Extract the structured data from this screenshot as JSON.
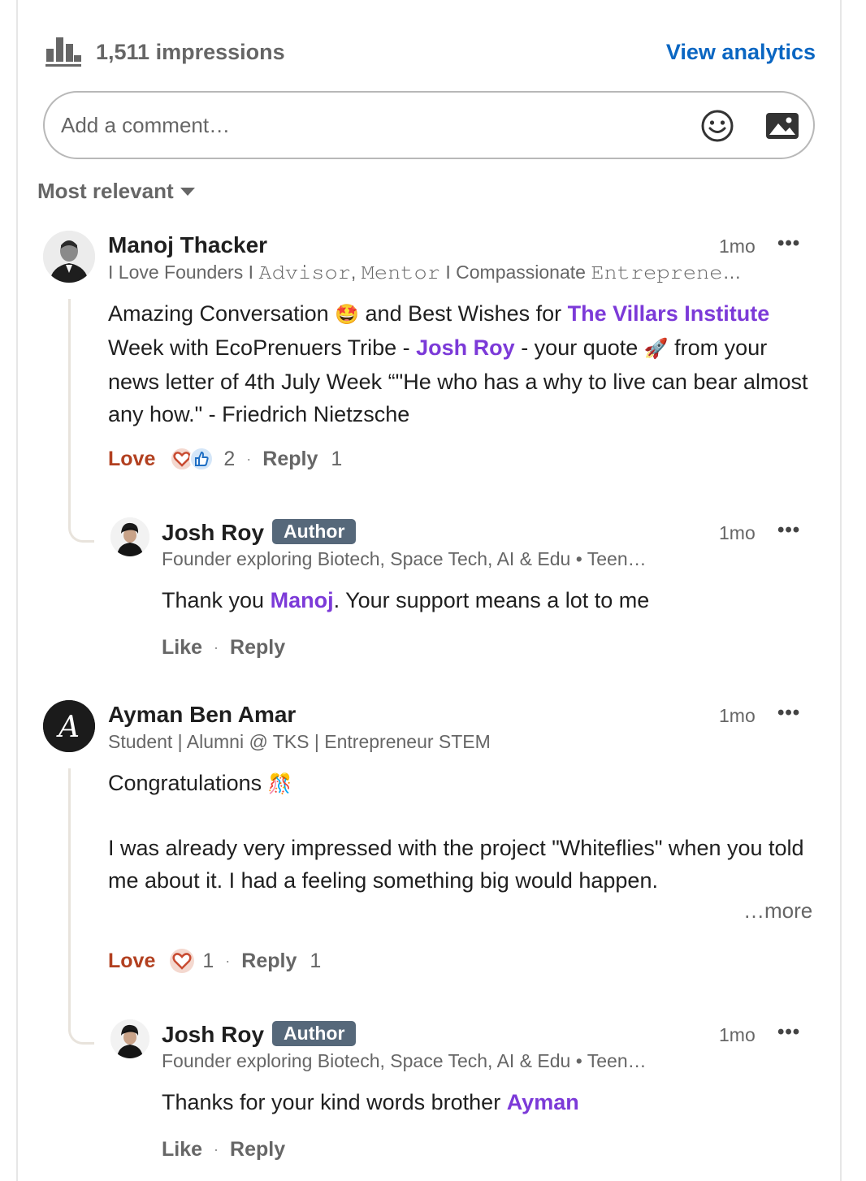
{
  "header": {
    "impressions": "1,511 impressions",
    "view_analytics": "View analytics",
    "accent": "#0a66c2"
  },
  "composer": {
    "placeholder": "Add a comment…",
    "emoji_icon": "smiley-icon",
    "image_icon": "image-icon"
  },
  "sort": {
    "label": "Most relevant"
  },
  "comments": [
    {
      "author": "Manoj Thacker",
      "headline": "I Love Founders I 𝙰𝚍𝚟𝚒𝚜𝚘𝚛, 𝙼𝚎𝚗𝚝𝚘𝚛 I Compassionate 𝙴𝚗𝚝𝚛𝚎𝚙𝚛𝚎𝚗𝚎…",
      "time": "1mo",
      "body_1": "Amazing Conversation ",
      "emoji_1": "🤩",
      "body_2": " and Best Wishes for ",
      "mention_1": "The Villars Institute",
      "body_3": " Week with EcoPrenuers Tribe - ",
      "mention_2": "Josh Roy",
      "body_4": " - your quote ",
      "emoji_2": "🚀",
      "body_5": " from your news letter of 4th July Week “\"He who has a why to live can bear almost any how.\" - Friedrich Nietzsche",
      "react_label": "Love",
      "react_count": "2",
      "reply_label": "Reply",
      "reply_count": "1",
      "reply": {
        "author": "Josh Roy",
        "badge": "Author",
        "headline": "Founder exploring Biotech, Space Tech, AI & Edu • Teen…",
        "time": "1mo",
        "body_1": "Thank you ",
        "mention": "Manoj",
        "body_2": ". Your support means a lot to me",
        "like_label": "Like",
        "reply_label": "Reply"
      }
    },
    {
      "author": "Ayman Ben Amar",
      "headline": "Student | Alumni @ TKS | Entrepreneur STEM",
      "time": "1mo",
      "body_1": "Congratulations ",
      "emoji_1": "🎊",
      "body_2": "I was already very impressed with the project \"Whiteflies\" when you told me about it. I had a feeling something big would happen.",
      "more": "…more",
      "react_label": "Love",
      "react_count": "1",
      "reply_label": "Reply",
      "reply_count": "1",
      "reply": {
        "author": "Josh Roy",
        "badge": "Author",
        "headline": "Founder exploring Biotech, Space Tech, AI & Edu • Teen…",
        "time": "1mo",
        "body_1": "Thanks for your kind words brother ",
        "mention": "Ayman",
        "like_label": "Like",
        "reply_label": "Reply"
      }
    }
  ],
  "colors": {
    "mention": "#7c3ad8",
    "love": "#b24020",
    "badge": "#56687a"
  }
}
